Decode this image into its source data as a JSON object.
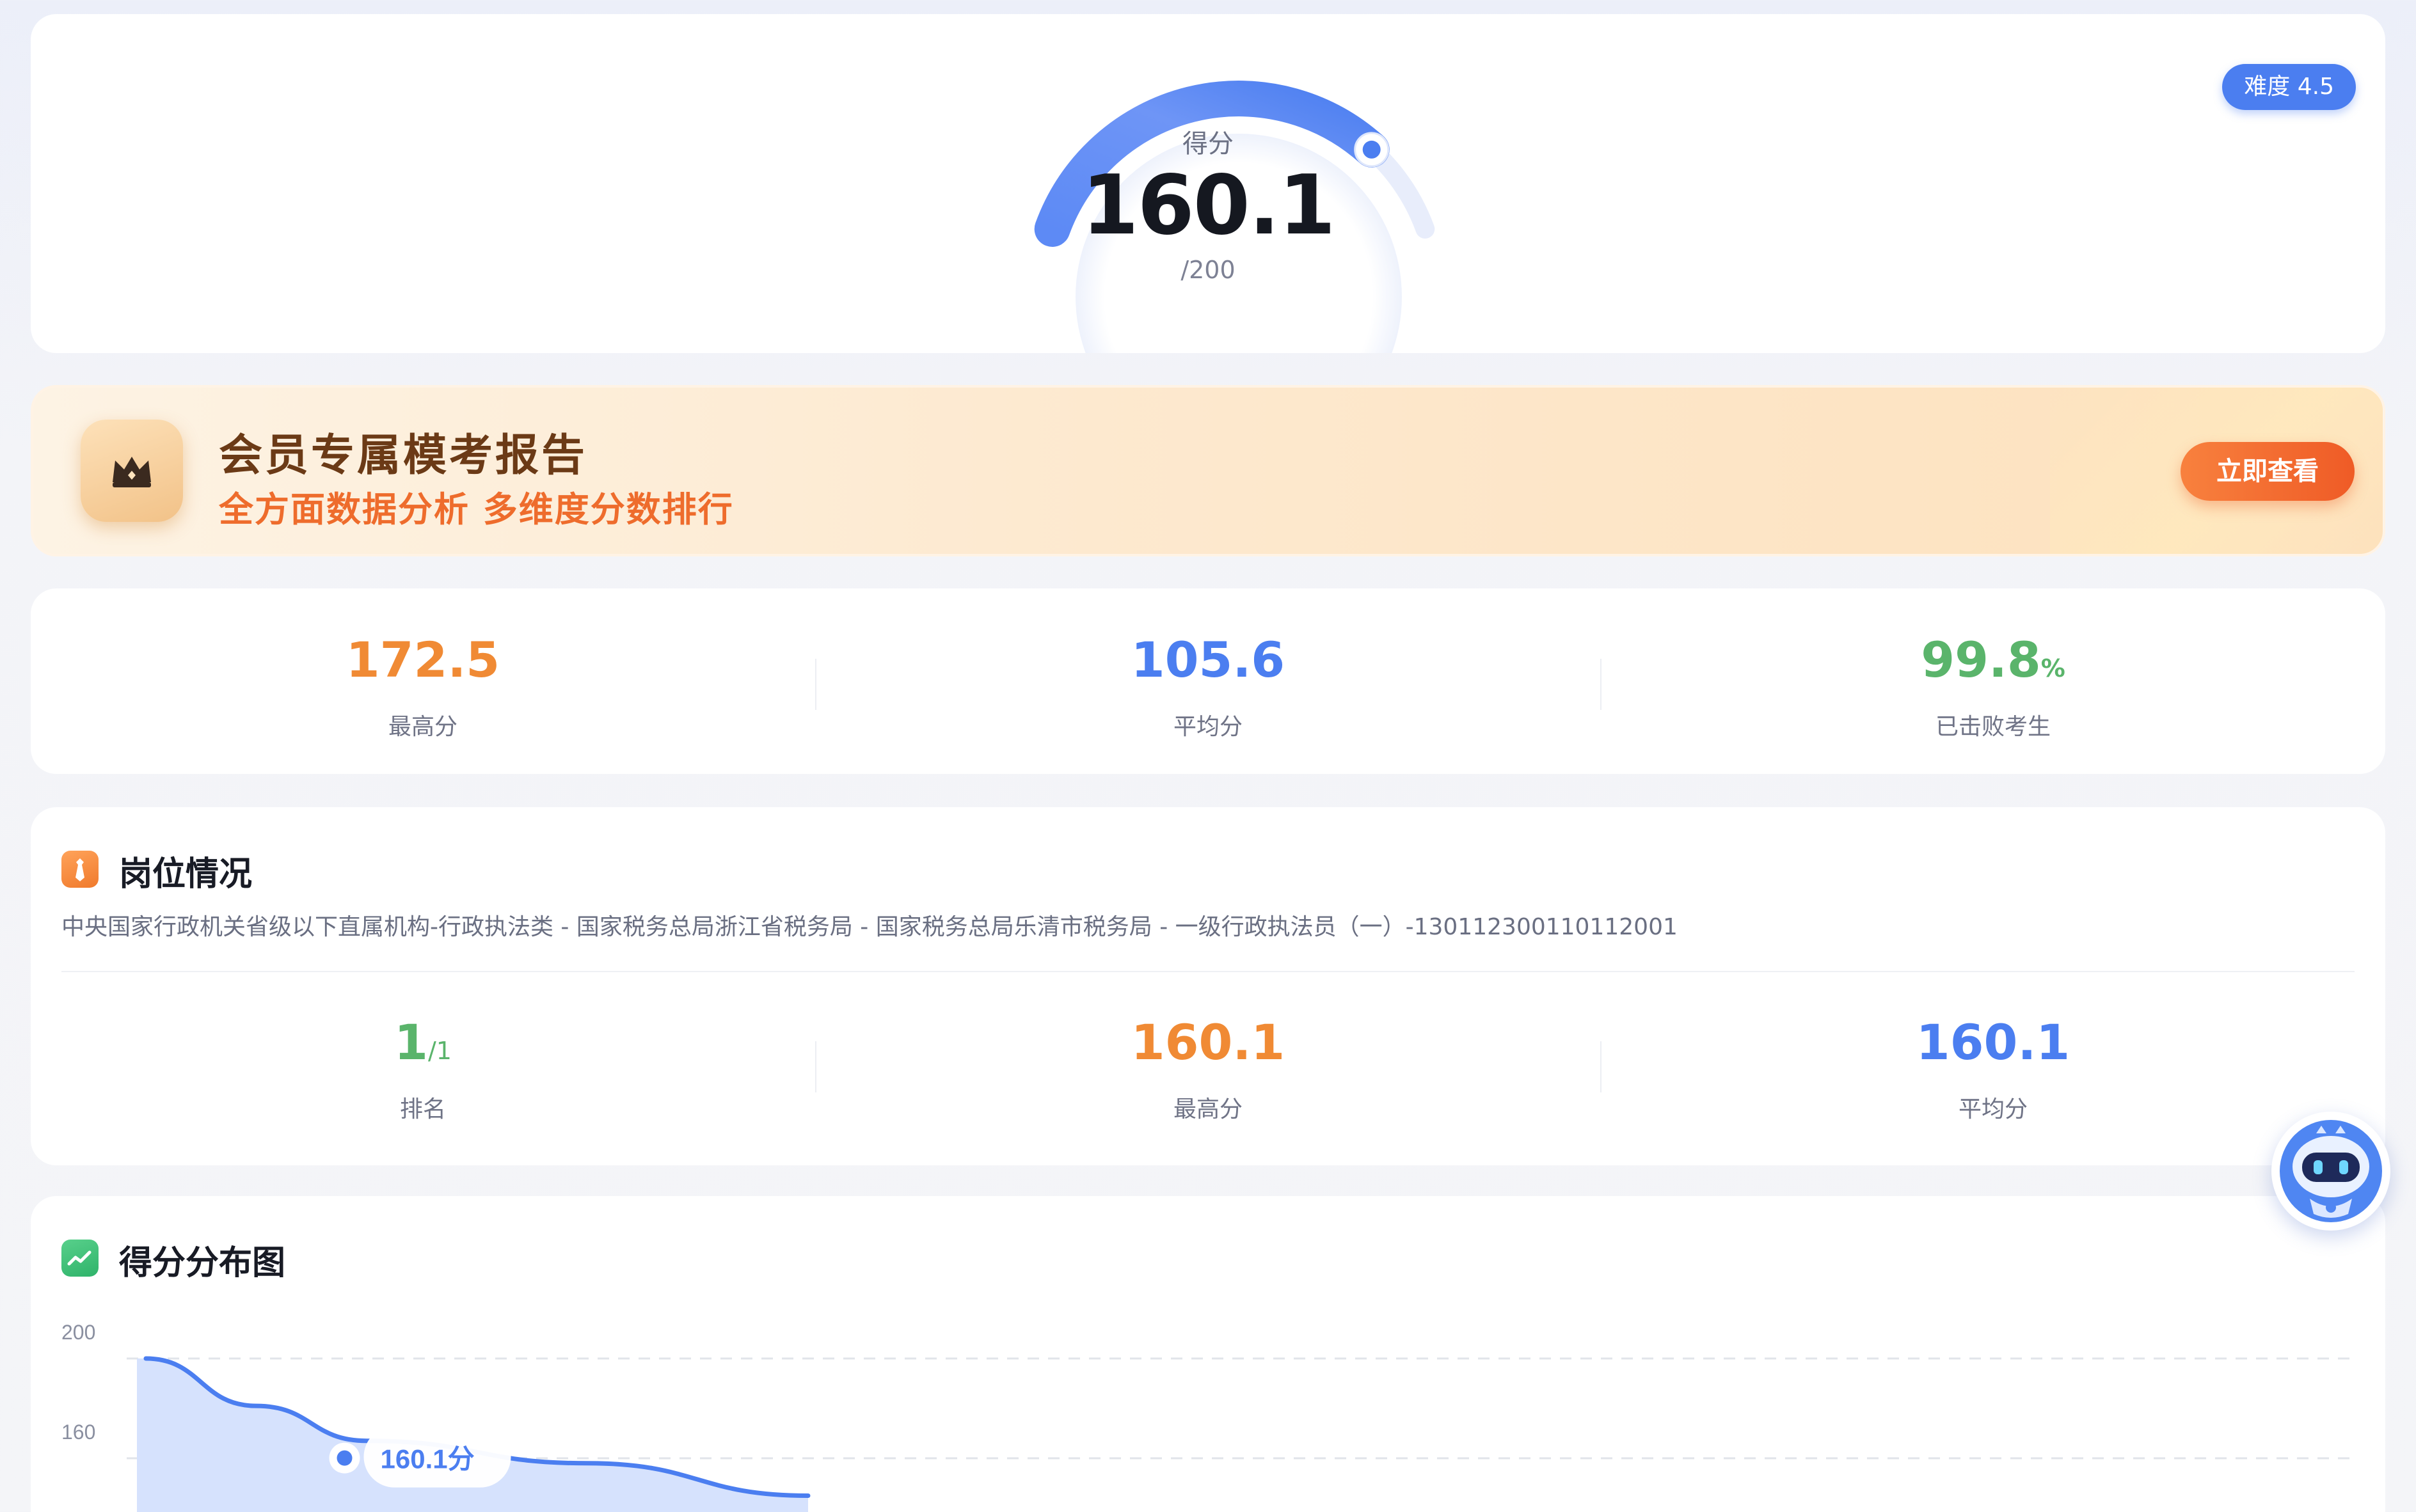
{
  "score": {
    "label": "得分",
    "value": "160.1",
    "total": "/200",
    "difficulty": "难度 4.5",
    "fraction": 0.8005
  },
  "member_banner": {
    "title": "会员专属模考报告",
    "subtitle": "全方面数据分析 多维度分数排行",
    "button": "立即查看",
    "icon": "crown-icon"
  },
  "stats": [
    {
      "value": "172.5",
      "unit": "",
      "label": "最高分",
      "color": "#f08a34"
    },
    {
      "value": "105.6",
      "unit": "",
      "label": "平均分",
      "color": "#4b7ef0"
    },
    {
      "value": "99.8",
      "unit": "%",
      "label": "已击败考生",
      "color": "#5ab46b"
    }
  ],
  "position": {
    "title": "岗位情况",
    "icon": "tie-icon",
    "path": "中央国家行政机关省级以下直属机构-行政执法类 - 国家税务总局浙江省税务局 - 国家税务总局乐清市税务局 - 一级行政执法员（一）-130112300110112001",
    "stats": [
      {
        "value": "1",
        "unit": "/1",
        "label": "排名",
        "color": "#5ab46b"
      },
      {
        "value": "160.1",
        "unit": "",
        "label": "最高分",
        "color": "#f08a34"
      },
      {
        "value": "160.1",
        "unit": "",
        "label": "平均分",
        "color": "#4b7ef0"
      }
    ]
  },
  "distribution": {
    "title": "得分分布图",
    "icon": "trend-chart-icon"
  },
  "chart_data": {
    "type": "area",
    "title": "得分分布图",
    "y_ticks": [
      "200",
      "160"
    ],
    "ylim": [
      0,
      200
    ],
    "x": [
      0.0,
      0.05,
      0.1,
      0.2,
      0.3
    ],
    "y": [
      200,
      181,
      167,
      158,
      145
    ],
    "marker": {
      "x": 0.09,
      "y": 160.1,
      "label": "160.1分"
    },
    "color": "#4b7ef0",
    "grid": true
  },
  "assistant": {
    "icon": "robot-assistant-icon"
  }
}
